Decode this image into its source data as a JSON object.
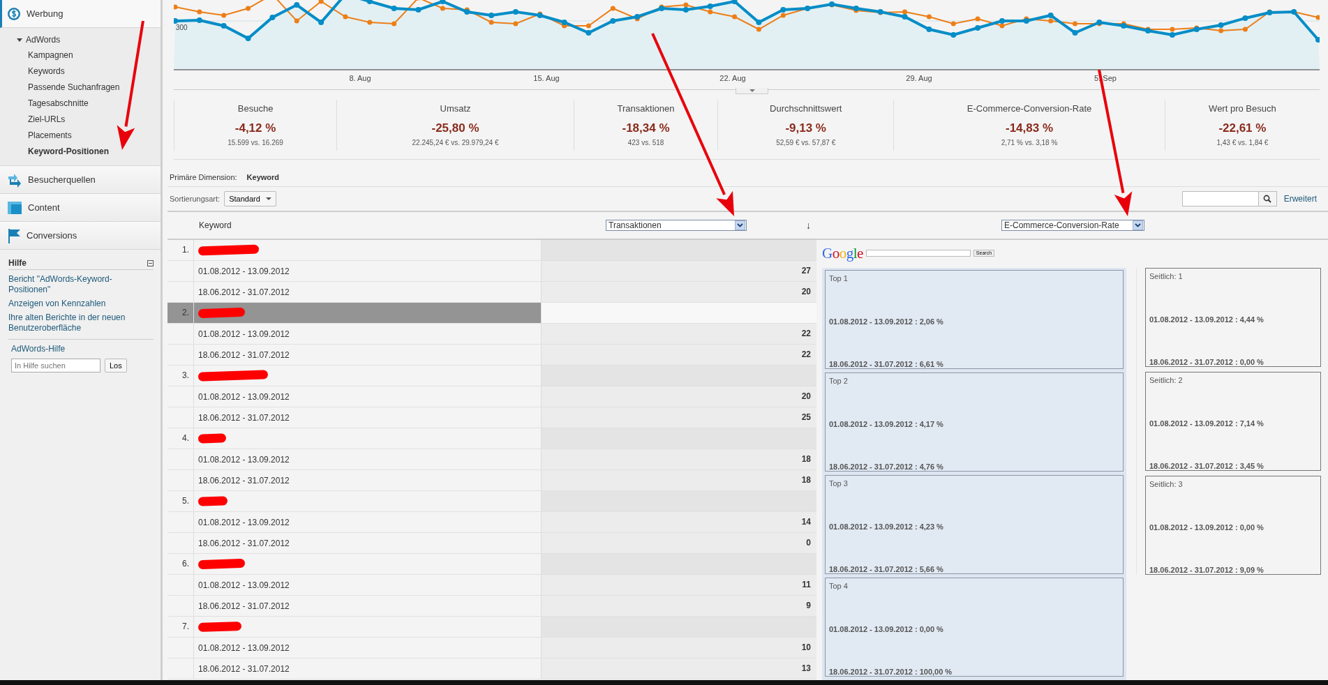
{
  "sidebar": {
    "sections": [
      {
        "label": "Werbung",
        "expanded": true,
        "children": [
          {
            "label": "AdWords",
            "expanded": true,
            "children": [
              {
                "label": "Kampagnen",
                "selected": false
              },
              {
                "label": "Keywords",
                "selected": false
              },
              {
                "label": "Passende Suchanfragen",
                "selected": false
              },
              {
                "label": "Tagesabschnitte",
                "selected": false
              },
              {
                "label": "Ziel-URLs",
                "selected": false
              },
              {
                "label": "Placements",
                "selected": false
              },
              {
                "label": "Keyword-Positionen",
                "selected": true
              }
            ]
          }
        ]
      },
      {
        "label": "Besucherquellen",
        "expanded": false
      },
      {
        "label": "Content",
        "expanded": false
      },
      {
        "label": "Conversions",
        "expanded": false
      }
    ],
    "help": {
      "title": "Hilfe",
      "links": [
        "Bericht \"AdWords-Keyword-Positionen\"",
        "Anzeigen von Kennzahlen",
        "Ihre alten Berichte in der neuen Benutzeroberfläche"
      ],
      "help_link": "AdWords-Hilfe",
      "search": {
        "placeholder": "In Hilfe suchen"
      },
      "search_button": "Los"
    }
  },
  "chart": {
    "y_tick": "300",
    "x_labels": [
      "8. Aug",
      "15. Aug",
      "22. Aug",
      "29. Aug",
      "5. Sep"
    ]
  },
  "metrics": [
    {
      "label": "Besuche",
      "change": "-4,12 %",
      "comparison": "15.599 vs. 16.269"
    },
    {
      "label": "Umsatz",
      "change": "-25,80 %",
      "comparison": "22.245,24 € vs. 29.979,24 €"
    },
    {
      "label": "Transaktionen",
      "change": "-18,34 %",
      "comparison": "423 vs. 518"
    },
    {
      "label": "Durchschnittswert",
      "change": "-9,13 %",
      "comparison": "52,59 € vs. 57,87 €"
    },
    {
      "label": "E-Commerce-Conversion-Rate",
      "change": "-14,83 %",
      "comparison": "2,71 % vs. 3,18 %"
    },
    {
      "label": "Wert pro Besuch",
      "change": "-22,61 %",
      "comparison": "1,43 € vs. 1,84 €"
    }
  ],
  "primary_dimension": {
    "label": "Primäre Dimension:",
    "value": "Keyword"
  },
  "sort": {
    "label": "Sortierungsart:",
    "value": "Standard"
  },
  "advanced_link": "Erweitert",
  "table": {
    "keyword_header": "Keyword",
    "metric": "Transaktionen",
    "sort_indicator": "↓",
    "rows": [
      {
        "number": "1.",
        "selected": false,
        "periods": [
          {
            "range": "01.08.2012 - 13.09.2012",
            "value": "27"
          },
          {
            "range": "18.06.2012 - 31.07.2012",
            "value": "20"
          }
        ]
      },
      {
        "number": "2.",
        "selected": true,
        "periods": [
          {
            "range": "01.08.2012 - 13.09.2012",
            "value": "22"
          },
          {
            "range": "18.06.2012 - 31.07.2012",
            "value": "22"
          }
        ]
      },
      {
        "number": "3.",
        "selected": false,
        "periods": [
          {
            "range": "01.08.2012 - 13.09.2012",
            "value": "20"
          },
          {
            "range": "18.06.2012 - 31.07.2012",
            "value": "25"
          }
        ]
      },
      {
        "number": "4.",
        "selected": false,
        "periods": [
          {
            "range": "01.08.2012 - 13.09.2012",
            "value": "18"
          },
          {
            "range": "18.06.2012 - 31.07.2012",
            "value": "18"
          }
        ]
      },
      {
        "number": "5.",
        "selected": false,
        "periods": [
          {
            "range": "01.08.2012 - 13.09.2012",
            "value": "14"
          },
          {
            "range": "18.06.2012 - 31.07.2012",
            "value": "0"
          }
        ]
      },
      {
        "number": "6.",
        "selected": false,
        "periods": [
          {
            "range": "01.08.2012 - 13.09.2012",
            "value": "11"
          },
          {
            "range": "18.06.2012 - 31.07.2012",
            "value": "9"
          }
        ]
      },
      {
        "number": "7.",
        "selected": false,
        "periods": [
          {
            "range": "01.08.2012 - 13.09.2012",
            "value": "10"
          },
          {
            "range": "18.06.2012 - 31.07.2012",
            "value": "13"
          }
        ]
      }
    ]
  },
  "positions": {
    "metric": "E-Commerce-Conversion-Rate",
    "logo": "Google",
    "search_button": "Search",
    "top": [
      {
        "label": "Top 1",
        "current": "01.08.2012 - 13.09.2012 : 2,06 %",
        "previous": "18.06.2012 - 31.07.2012 : 6,61 %"
      },
      {
        "label": "Top 2",
        "current": "01.08.2012 - 13.09.2012 : 4,17 %",
        "previous": "18.06.2012 - 31.07.2012 : 4,76 %"
      },
      {
        "label": "Top 3",
        "current": "01.08.2012 - 13.09.2012 : 4,23 %",
        "previous": "18.06.2012 - 31.07.2012 : 5,66 %"
      },
      {
        "label": "Top 4",
        "current": "01.08.2012 - 13.09.2012 : 0,00 %",
        "previous": "18.06.2012 - 31.07.2012 : 100,00 %"
      }
    ],
    "side": [
      {
        "label": "Seitlich: 1",
        "current": "01.08.2012 - 13.09.2012 : 4,44 %",
        "previous": "18.06.2012 - 31.07.2012 : 0,00 %"
      },
      {
        "label": "Seitlich: 2",
        "current": "01.08.2012 - 13.09.2012 : 7,14 %",
        "previous": "18.06.2012 - 31.07.2012 : 3,45 %"
      },
      {
        "label": "Seitlich: 3",
        "current": "01.08.2012 - 13.09.2012 : 0,00 %",
        "previous": "18.06.2012 - 31.07.2012 : 9,09 %"
      }
    ]
  }
}
